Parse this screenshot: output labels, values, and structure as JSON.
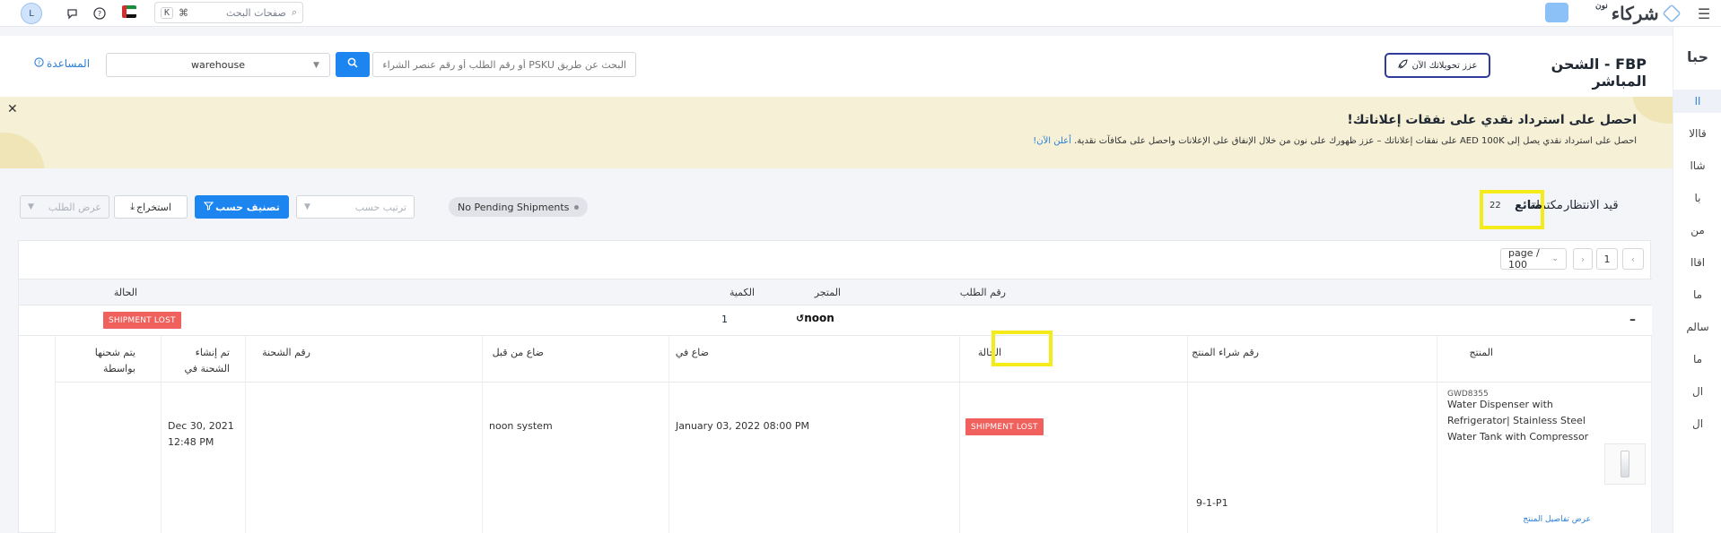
{
  "topbar": {
    "user_initial": "L",
    "search_placeholder": "صفحات البحث",
    "search_shortcut_key": "K",
    "search_shortcut_mod": "⌘",
    "brand_name": "شركاء",
    "brand_super": "نون",
    "flag_colors": [
      "#d32f2f",
      "#1b8a3a",
      "#ffffff",
      "#111111"
    ]
  },
  "header": {
    "title": "FBP - الشحن المباشر",
    "boost_button": "عزز تحويلاتك الآن",
    "search_placeholder": "البحث عن طريق PSKU أو رقم الطلب أو رقم عنصر الشراء",
    "warehouse_value": "warehouse",
    "help_link": "المساعدة"
  },
  "rail": {
    "head": "حبا",
    "items": [
      "اا",
      "قاالا",
      "شاا",
      "با",
      "من",
      "اقاا",
      "ما",
      "سالم",
      "ما",
      "ال",
      "ال"
    ]
  },
  "banner": {
    "title": "احصل على استرداد نقدي على نفقات إعلاناتك!",
    "text": "احصل على استرداد نقدي يصل إلى AED 100K على نفقات إعلاناتك – عزز ظهورك على نون من خلال الإنفاق على الإعلانات واحصل على مكافآت نقدية.",
    "link": "أعلن الآن!"
  },
  "filters": {
    "tab_pending": "قيد الانتظار",
    "tab_complete": "مكتملة",
    "tab_lost": "ضائع",
    "tab_lost_count": "22",
    "pending_pill": "No Pending Shipments",
    "order_by_placeholder": "ترتيب حسب",
    "sort_button": "تصنيف حسب",
    "export_button": "استخراج",
    "show_order": "عرض الطلب"
  },
  "pager": {
    "page": "1",
    "per_page": "page / 100"
  },
  "orders_table": {
    "columns": [
      "رقم الطلب",
      "المتجر",
      "الكمية",
      "الحالة"
    ],
    "row": {
      "store": "noon",
      "quantity": "1",
      "status": "SHIPMENT LOST"
    }
  },
  "shipment_table": {
    "columns": [
      "المنتج",
      "رقم شراء المنتج",
      "الحالة",
      "ضاع في",
      "ضاع من قبل",
      "رقم الشحنة",
      "تم إنشاء الشحنة في",
      "يتم شحنها بواسطة"
    ],
    "row": {
      "sku": "GWD8355",
      "product_name": "Water Dispenser with Refrigerator| Stainless Steel Water Tank with Compressor",
      "product_link": "عرض تفاصيل المنتج",
      "purchase_no": "9-1-P1",
      "status": "SHIPMENT LOST",
      "lost_at": "January 03, 2022 08:00 PM",
      "lost_by": "noon system",
      "shipment_no": "",
      "created_date": "Dec 30, 2021",
      "created_time": "12:48 PM",
      "shipped_by": ""
    }
  },
  "colors": {
    "accent": "#1d85f0",
    "danger": "#f0605d",
    "highlight": "#f5ea1a",
    "banner": "#f5f0d6"
  }
}
